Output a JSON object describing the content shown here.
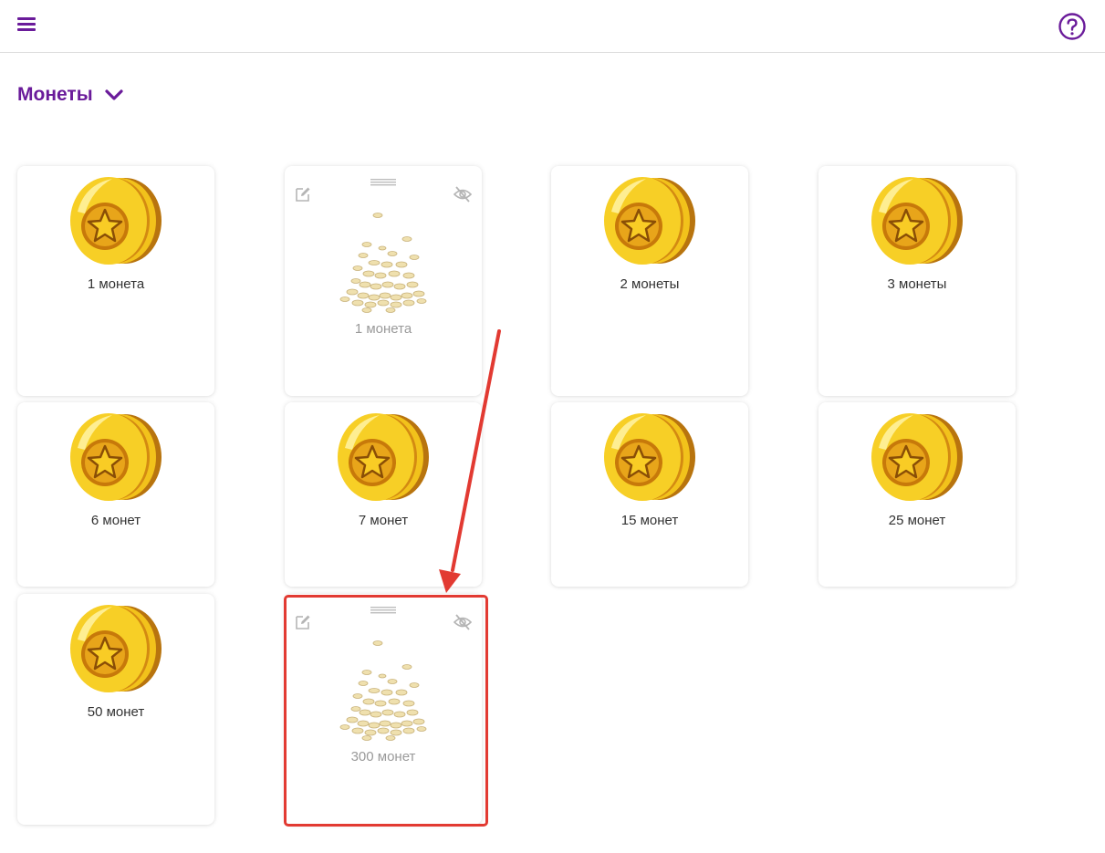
{
  "header": {
    "menu_icon": "hamburger-menu-icon",
    "help_icon": "question-circle-icon"
  },
  "section": {
    "title": "Монеты",
    "toggle_icon": "chevron-down-icon"
  },
  "colors": {
    "accent": "#6a1b9a",
    "highlight": "#e23a32",
    "coin_gold": "#f2c21b",
    "hidden_label": "#9a9a9a"
  },
  "cards": [
    {
      "label": "1 монета",
      "image": "gold-coin-star-icon",
      "hidden": false
    },
    {
      "label": "1 монета",
      "image": "coin-pile-icon",
      "hidden": true
    },
    {
      "label": "2 монеты",
      "image": "gold-coin-star-icon",
      "hidden": false
    },
    {
      "label": "3 монеты",
      "image": "gold-coin-star-icon",
      "hidden": false
    },
    {
      "label": "6 монет",
      "image": "gold-coin-star-icon",
      "hidden": false
    },
    {
      "label": "7 монет",
      "image": "gold-coin-star-icon",
      "hidden": false
    },
    {
      "label": "15 монет",
      "image": "gold-coin-star-icon",
      "hidden": false
    },
    {
      "label": "25 монет",
      "image": "gold-coin-star-icon",
      "hidden": false
    },
    {
      "label": "50 монет",
      "image": "gold-coin-star-icon",
      "hidden": false
    },
    {
      "label": "300 монет",
      "image": "coin-pile-icon",
      "hidden": true
    }
  ],
  "hidden_card_icons": [
    "edit-pencil-icon",
    "drag-handle-icon",
    "eye-off-icon"
  ],
  "annotation": {
    "type": "arrow-and-box",
    "target_card": "300 монет"
  }
}
